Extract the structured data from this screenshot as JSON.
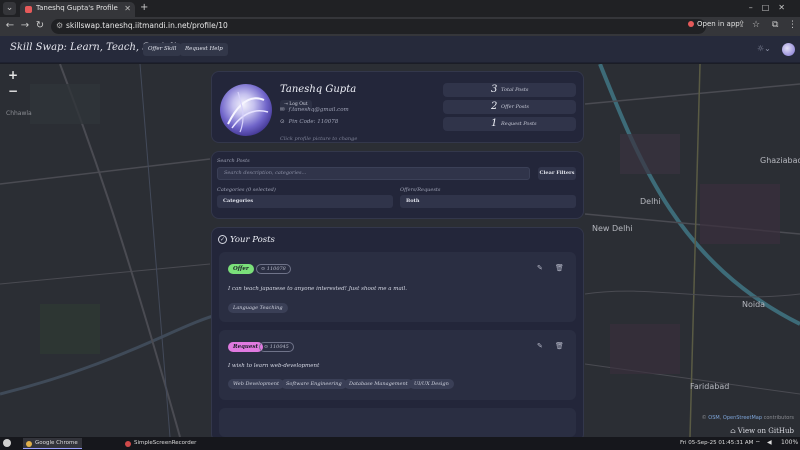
{
  "browser": {
    "tab_title": "Taneshq Gupta's Profile - Sk",
    "url": "skillswap.taneshq.iitmandi.in.net/profile/10",
    "open_in_app": "Open in app"
  },
  "header": {
    "logo": "Skill Swap: Learn, Teach, Socialise",
    "nav": [
      "Offer Skill",
      "Request Help"
    ]
  },
  "profile": {
    "name": "Taneshq Gupta",
    "logout_label": "Log Out",
    "email": "f.taneshq@gmail.com",
    "pin_code_label": "Pin Code: 110078",
    "change_hint": "Click profile picture to change",
    "stats": [
      {
        "value": "3",
        "label": "Total Posts"
      },
      {
        "value": "2",
        "label": "Offer Posts"
      },
      {
        "value": "1",
        "label": "Request Posts"
      }
    ]
  },
  "filters": {
    "search_label": "Search Posts",
    "search_placeholder": "Search description, categories...",
    "clear_label": "Clear Filters",
    "categories_label": "Categories (0 selected)",
    "categories_value": "Categories",
    "type_label": "Offers/Requests",
    "type_value": "Both"
  },
  "posts": {
    "title": "Your Posts",
    "items": [
      {
        "type": "Offer",
        "pin": "110078",
        "text": "I can teach japanese to anyone interested! Just shoot me a mail.",
        "tags": [
          "Language Teaching"
        ]
      },
      {
        "type": "Request",
        "pin": "110045",
        "text": "I wish to learn web-development",
        "tags": [
          "Web Development",
          "Software Engineering",
          "Database Management",
          "UI/UX Design"
        ]
      }
    ]
  },
  "map": {
    "labels": [
      "Chhawla",
      "New Delhi",
      "Delhi",
      "Noida",
      "Ghaziabad",
      "Faridabad"
    ],
    "attribution_prefix": "© ",
    "attribution_links": [
      "OSM",
      "OpenStreetMap"
    ],
    "attribution_suffix": " contributors",
    "github_link": "View on GitHub"
  },
  "taskbar": {
    "apps": [
      "Google Chrome",
      "SimpleScreenRecorder"
    ],
    "clock": "Fri 05-Sep-25 01:45:31 AM",
    "battery": "100%"
  },
  "colors": {
    "offer_badge": "#7be07a",
    "request_badge": "#e07ae0",
    "panel_bg": "#23263a"
  }
}
